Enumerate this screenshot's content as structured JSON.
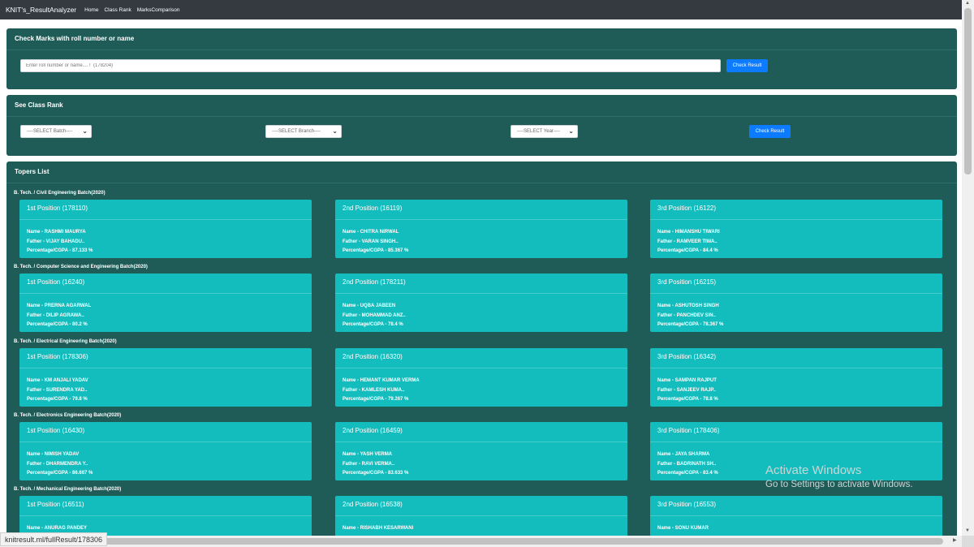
{
  "navbar": {
    "brand": "KNIT's_ResultAnalyzer",
    "links": [
      "Home",
      "Class Rank",
      "MarksComparison"
    ]
  },
  "check_marks": {
    "title": "Check Marks with roll number or name",
    "placeholder": "Enter roll number or name.... !  (178204)",
    "button": "Check Result"
  },
  "class_rank": {
    "title": "See Class Rank",
    "batch": "----SELECT Batch----",
    "branch": "----SELECT Branch----",
    "year": "----SELECT Year----",
    "button": "Check Result"
  },
  "toppers": {
    "title": "Topers List",
    "branches": [
      {
        "label": "B. Tech. / Civil Engineering Batch(2020)",
        "cards": [
          {
            "position": "1st Position (178110)",
            "name": "Name - RASHMI MAURYA",
            "father": "Father - VIJAY BAHADU..",
            "percentage": "Percentage/CGPA - 87.133 %"
          },
          {
            "position": "2nd Position (16119)",
            "name": "Name - CHITRA NIRWAL",
            "father": "Father - VARAN SINGH..",
            "percentage": "Percentage/CGPA - 85.367 %"
          },
          {
            "position": "3rd Position (16122)",
            "name": "Name - HIMANSHU TIWARI",
            "father": "Father - RAMVEER TIWA..",
            "percentage": "Percentage/CGPA - 84.4 %"
          }
        ]
      },
      {
        "label": "B. Tech. / Computer Science and Engineering Batch(2020)",
        "cards": [
          {
            "position": "1st Position (16240)",
            "name": "Name - PRERNA AGARWAL",
            "father": "Father - DILIP AGRAWA..",
            "percentage": "Percentage/CGPA - 80.2 %"
          },
          {
            "position": "2nd Position (178211)",
            "name": "Name - UQBA JABEEN",
            "father": "Father - MOHAMMAD ANZ..",
            "percentage": "Percentage/CGPA - 78.4 %"
          },
          {
            "position": "3rd Position (16215)",
            "name": "Name - ASHUTOSH SINGH",
            "father": "Father - PANCHDEV SIN..",
            "percentage": "Percentage/CGPA - 78.367 %"
          }
        ]
      },
      {
        "label": "B. Tech. / Electrical Engineering Batch(2020)",
        "cards": [
          {
            "position": "1st Position (178306)",
            "name": "Name - KM ANJALI YADAV",
            "father": "Father - SURENDRA YAD..",
            "percentage": "Percentage/CGPA - 79.8 %"
          },
          {
            "position": "2nd Position (16320)",
            "name": "Name - HEMANT KUMAR VERMA",
            "father": "Father - KAMLESH KUMA..",
            "percentage": "Percentage/CGPA - 79.267 %"
          },
          {
            "position": "3rd Position (16342)",
            "name": "Name - SAMPAN RAJPUT",
            "father": "Father - SANJEEV RAJP..",
            "percentage": "Percentage/CGPA - 78.8 %"
          }
        ]
      },
      {
        "label": "B. Tech. / Electronics Engineering Batch(2020)",
        "cards": [
          {
            "position": "1st Position (16430)",
            "name": "Name - NIMISH YADAV",
            "father": "Father - DHARMENDRA Y..",
            "percentage": "Percentage/CGPA - 86.667 %"
          },
          {
            "position": "2nd Position (16459)",
            "name": "Name - YASH VERMA",
            "father": "Father - RAVI VERMA..",
            "percentage": "Percentage/CGPA - 83.633 %"
          },
          {
            "position": "3rd Position (178406)",
            "name": "Name - JAYA SHARMA",
            "father": "Father - BADRINATH SH..",
            "percentage": "Percentage/CGPA - 83.4 %"
          }
        ]
      },
      {
        "label": "B. Tech. / Mechanical Engineering Batch(2020)",
        "cards": [
          {
            "position": "1st Position (16511)",
            "name": "Name - ANURAG PANDEY",
            "father": "",
            "percentage": ""
          },
          {
            "position": "2nd Position (16538)",
            "name": "Name - RISHABH KESARWANI",
            "father": "",
            "percentage": ""
          },
          {
            "position": "3rd Position (16553)",
            "name": "Name - SONU KUMAR",
            "father": "",
            "percentage": ""
          }
        ]
      }
    ]
  },
  "watermark": {
    "line1": "Activate Windows",
    "line2": "Go to Settings to activate Windows."
  },
  "status_bar": {
    "url": "knitresult.ml/fullResult/178306"
  }
}
